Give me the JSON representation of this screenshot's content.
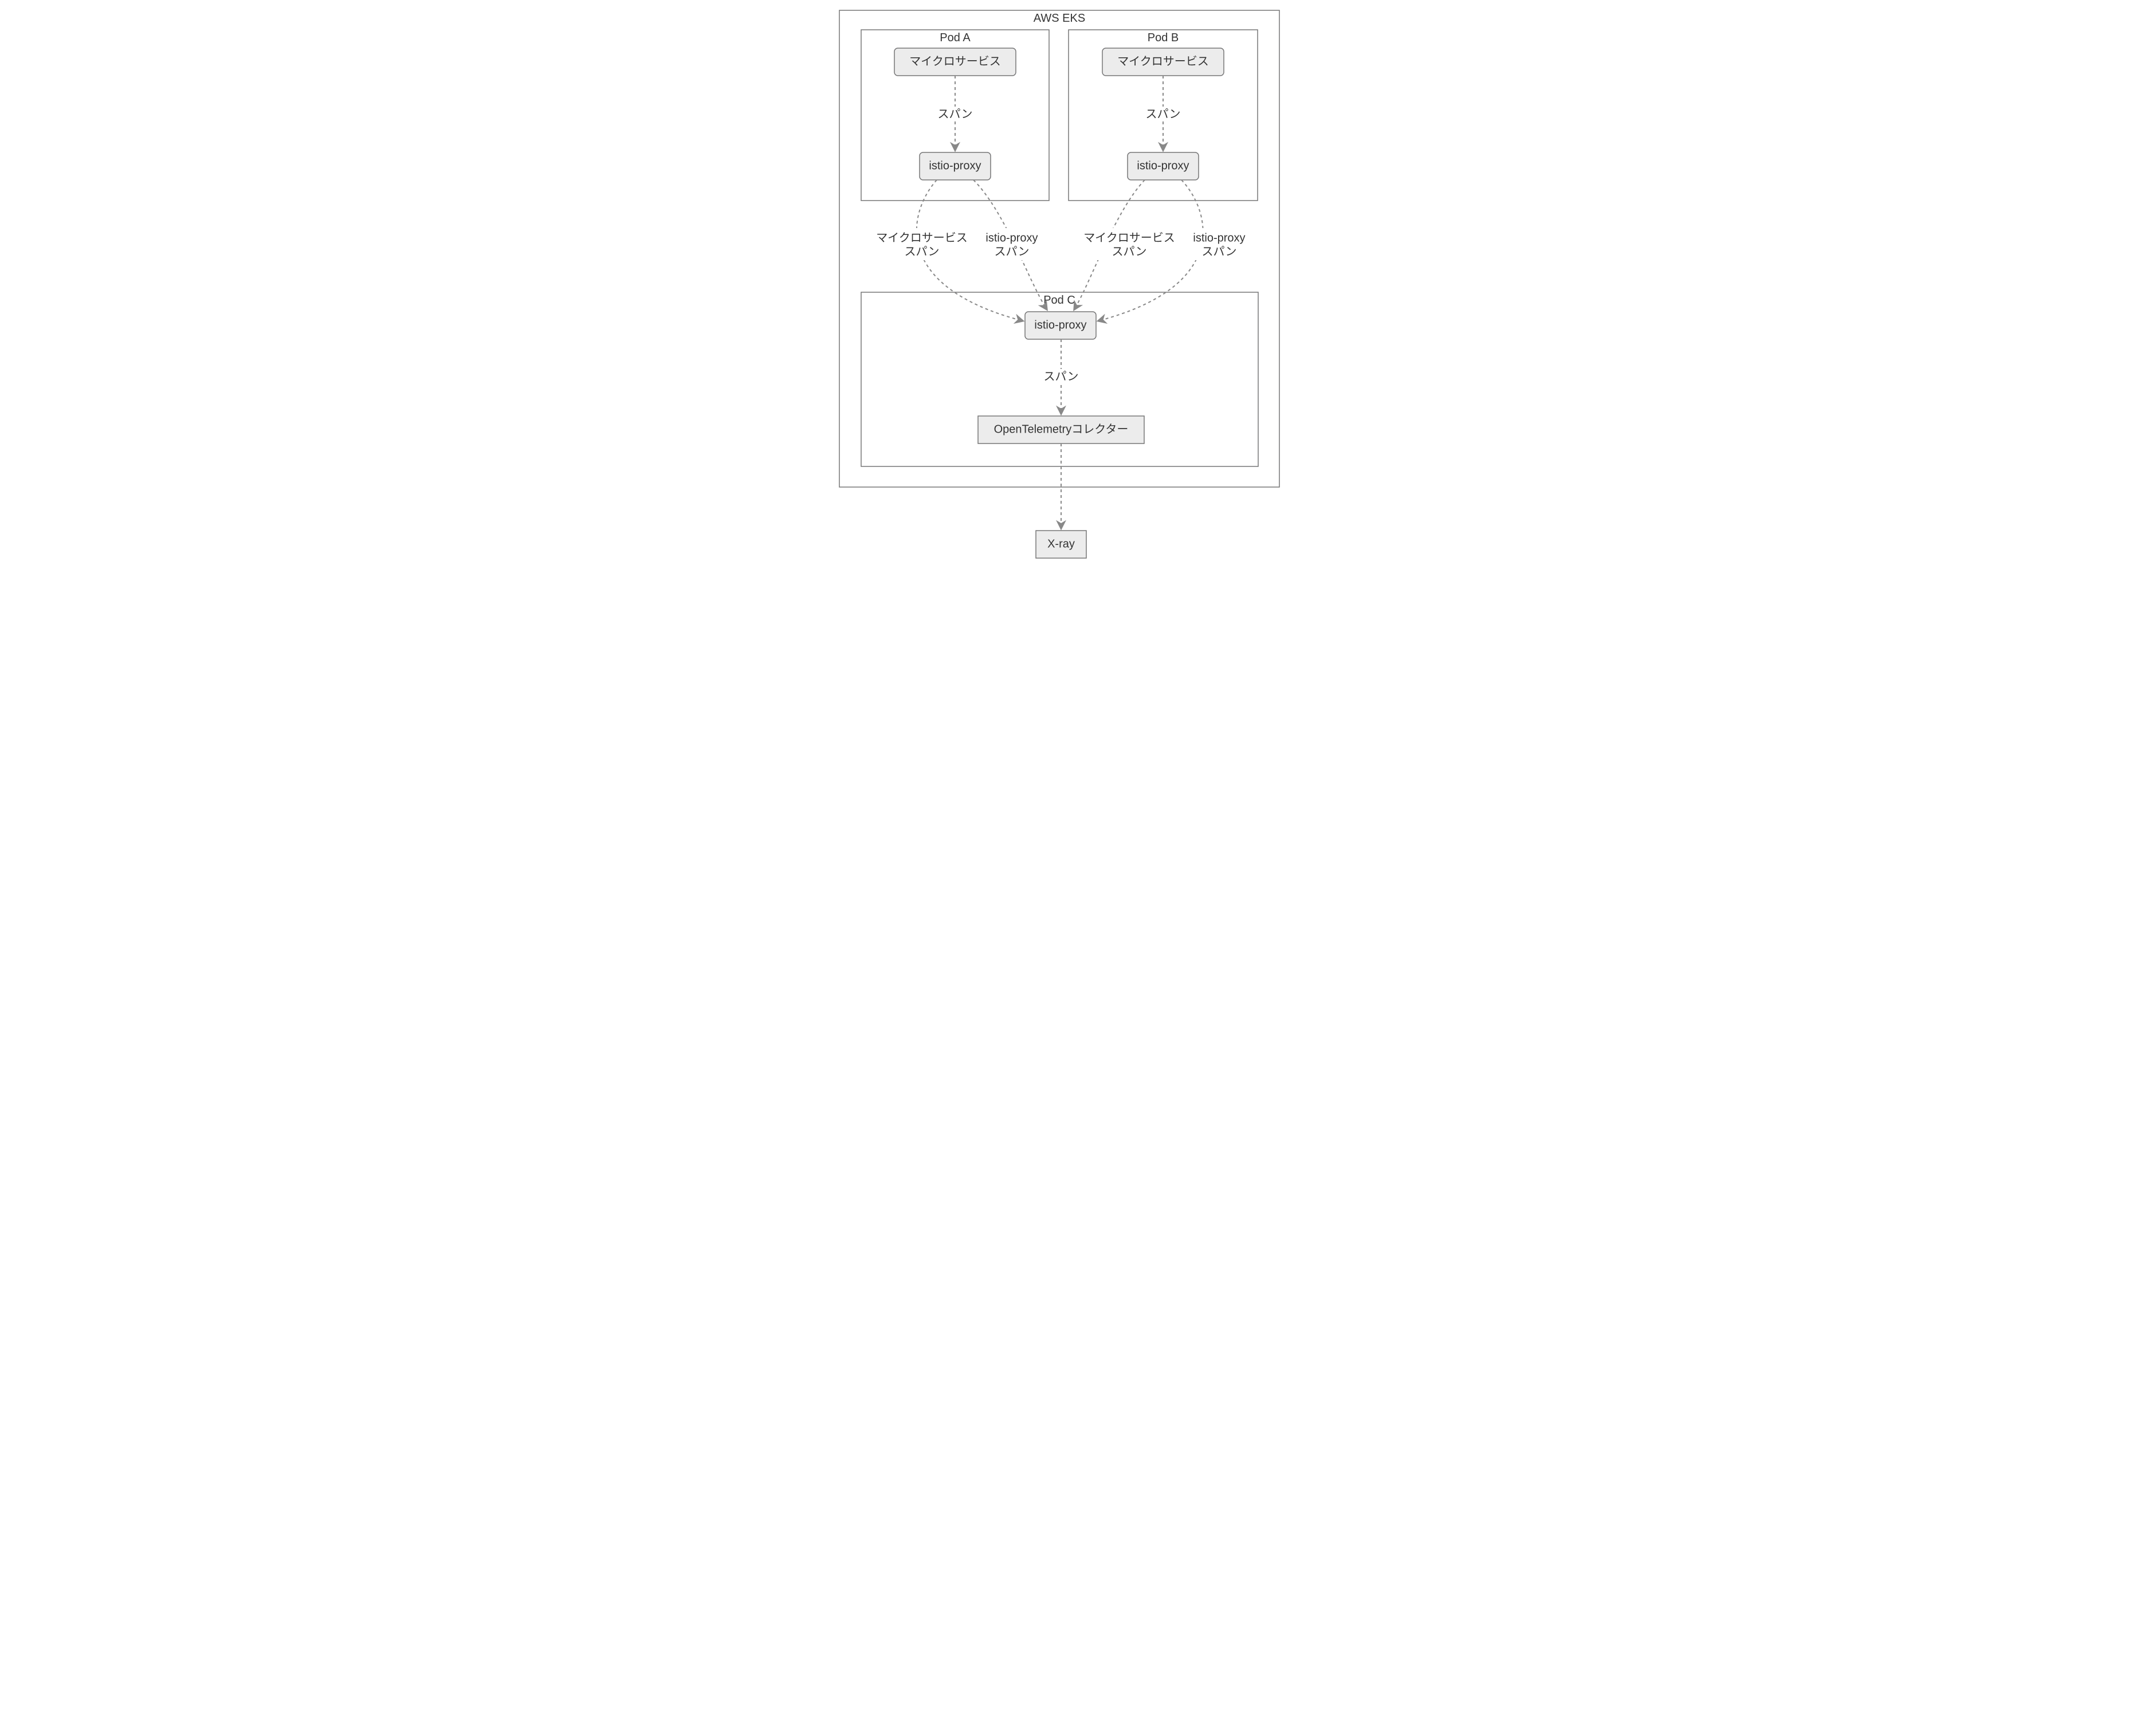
{
  "clusters": {
    "eks": {
      "title": "AWS EKS"
    },
    "podA": {
      "title": "Pod A"
    },
    "podB": {
      "title": "Pod B"
    },
    "podC": {
      "title": "Pod C"
    }
  },
  "nodes": {
    "a_ms": "マイクロサービス",
    "a_proxy": "istio-proxy",
    "b_ms": "マイクロサービス",
    "b_proxy": "istio-proxy",
    "c_proxy": "istio-proxy",
    "c_collector": "OpenTelemetryコレクター",
    "xray": "X-ray"
  },
  "edge_labels": {
    "a_span": "スパン",
    "b_span": "スパン",
    "c_span": "スパン",
    "a_ms_span_l1": "マイクロサービス",
    "a_ms_span_l2": "スパン",
    "a_proxy_span_l1": "istio-proxy",
    "a_proxy_span_l2": "スパン",
    "b_ms_span_l1": "マイクロサービス",
    "b_ms_span_l2": "スパン",
    "b_proxy_span_l1": "istio-proxy",
    "b_proxy_span_l2": "スパン"
  }
}
